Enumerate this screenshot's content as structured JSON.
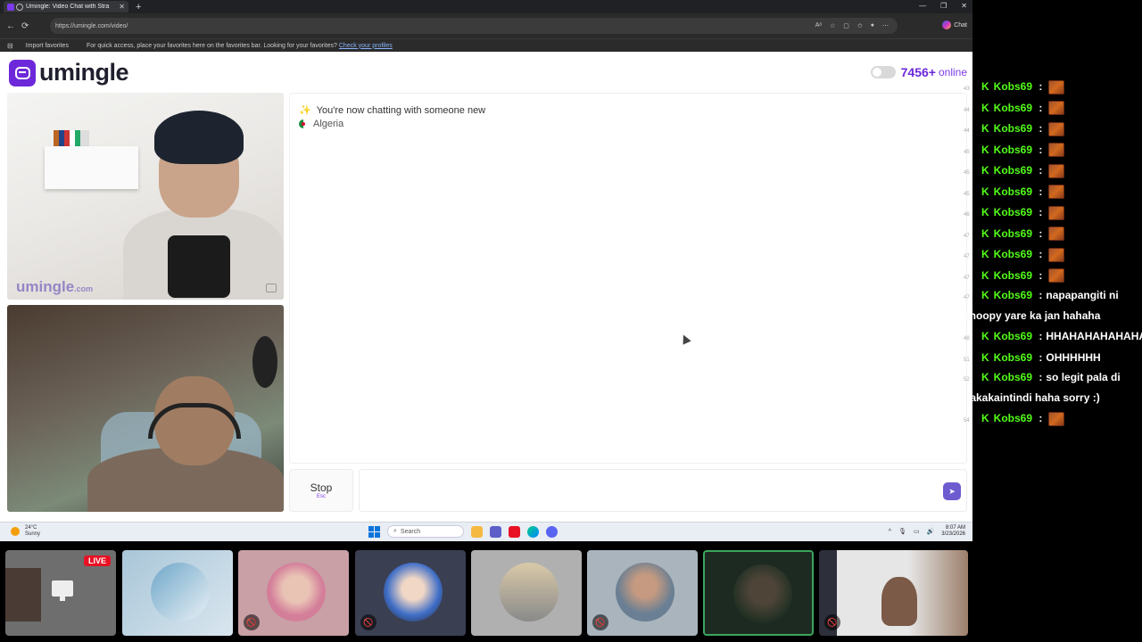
{
  "browser": {
    "tab_title": "Umingle: Video Chat with Stra",
    "url": "https://umingle.com/video/",
    "copilot_label": "Chat",
    "fav_import": "Import favorites",
    "fav_hint": "For quick access, place your favorites here on the favorites bar. Looking for your favorites?",
    "fav_link": "Check your profiles"
  },
  "site": {
    "logo": "umingle",
    "online_count": "7456+",
    "online_label": "online",
    "watermark": "umingle",
    "watermark_tld": ".com"
  },
  "chat": {
    "system_message": "You're now chatting with someone new",
    "country": "Algeria",
    "stop_label": "Stop",
    "stop_hint": "Esc",
    "input_placeholder": ""
  },
  "taskbar": {
    "temp": "24°C",
    "condition": "Sunny",
    "search": "Search",
    "time": "8:07 AM",
    "date": "3/23/2026"
  },
  "tiles": {
    "live_label": "LIVE"
  },
  "stream_chat": [
    {
      "ts": "43",
      "user": "Kobs69",
      "sep": ":",
      "text": "",
      "emote": true
    },
    {
      "ts": "44",
      "user": "Kobs69",
      "sep": ":",
      "text": "",
      "emote": true
    },
    {
      "ts": "44",
      "user": "Kobs69",
      "sep": ":",
      "text": "",
      "emote": true
    },
    {
      "ts": "45",
      "user": "Kobs69",
      "sep": ":",
      "text": "",
      "emote": true
    },
    {
      "ts": "45",
      "user": "Kobs69",
      "sep": ":",
      "text": "",
      "emote": true
    },
    {
      "ts": "45",
      "user": "Kobs69",
      "sep": ":",
      "text": "",
      "emote": true
    },
    {
      "ts": "46",
      "user": "Kobs69",
      "sep": ":",
      "text": "",
      "emote": true
    },
    {
      "ts": "47",
      "user": "Kobs69",
      "sep": ":",
      "text": "",
      "emote": true
    },
    {
      "ts": "47",
      "user": "Kobs69",
      "sep": ":",
      "text": "",
      "emote": true
    },
    {
      "ts": "47",
      "user": "Kobs69",
      "sep": ":",
      "text": "",
      "emote": true
    },
    {
      "ts": "47",
      "user": "Kobs69",
      "sep": ":",
      "text": "napapangiti ni snoopy yare ka jan hahaha",
      "emote": false
    },
    {
      "ts": "48",
      "user": "Kobs69",
      "sep": ":",
      "text": "HHAHAHAHAHAHA",
      "emote": false
    },
    {
      "ts": "51",
      "user": "Kobs69",
      "sep": ":",
      "text": "OHHHHHH",
      "emote": false
    },
    {
      "ts": "52",
      "user": "Kobs69",
      "sep": ":",
      "text": "so legit pala di nakakaintindi haha sorry :)",
      "emote": false
    },
    {
      "ts": "54",
      "user": "Kobs69",
      "sep": ":",
      "text": "",
      "emote": true
    }
  ]
}
